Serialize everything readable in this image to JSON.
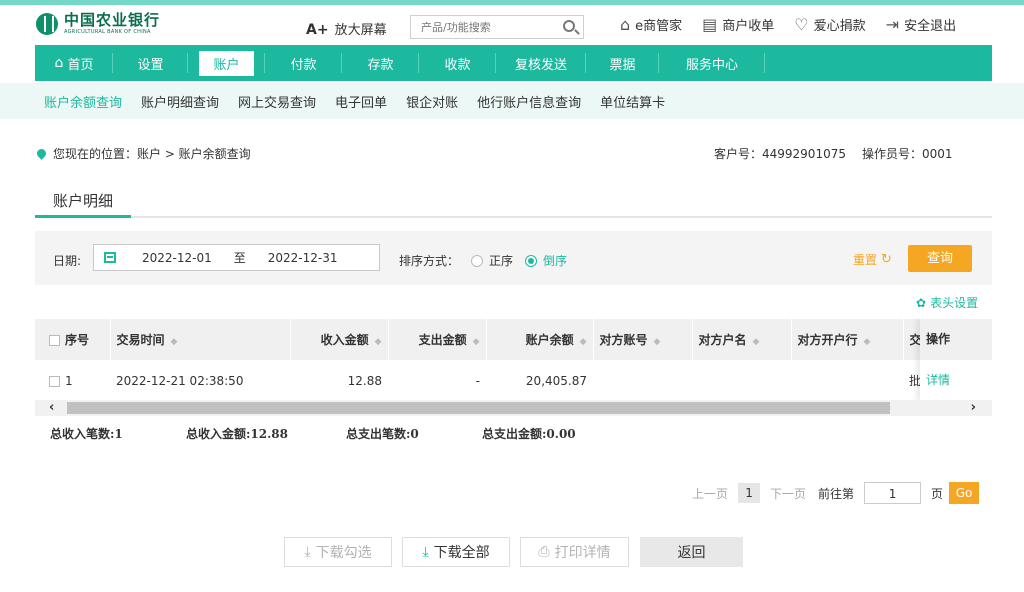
{
  "brand": {
    "name_cn": "中国农业银行",
    "name_en": "AGRICULTURAL BANK OF CHINA"
  },
  "header": {
    "zoom_symbol": "A+",
    "zoom_label": "放大屏幕",
    "search_placeholder": "产品/功能搜索",
    "links": [
      "e商管家",
      "商户收单",
      "爱心捐款",
      "安全退出"
    ]
  },
  "nav": {
    "items": [
      "首页",
      "设置",
      "账户",
      "付款",
      "存款",
      "收款",
      "复核发送",
      "票据",
      "服务中心"
    ],
    "active": "账户"
  },
  "subnav": {
    "items": [
      "账户余额查询",
      "账户明细查询",
      "网上交易查询",
      "电子回单",
      "银企对账",
      "他行账户信息查询",
      "单位结算卡"
    ],
    "active": "账户余额查询"
  },
  "breadcrumb": {
    "text": "您现在的位置：账户 > 账户余额查询"
  },
  "customer": {
    "label": "客户号：44992901075",
    "operator": "操作员号：0001"
  },
  "section": {
    "tab": "账户明细"
  },
  "filter": {
    "date_label": "日期:",
    "start_date": "2022-12-01",
    "to": "至",
    "end_date": "2022-12-31",
    "sort_label": "排序方式：",
    "sort_asc": "正序",
    "sort_desc": "倒序",
    "sort_selected": "倒序",
    "reset": "重置",
    "query": "查询"
  },
  "column_settings": "表头设置",
  "table": {
    "headers": [
      "序号",
      "交易时间",
      "收入金额",
      "支出金额",
      "账户余额",
      "对方账号",
      "对方户名",
      "对方开户行",
      "交易"
    ],
    "rows": [
      {
        "index": "1",
        "time": "2022-12-21 02:38:50",
        "income": "12.88",
        "expense": "-",
        "balance": "20,405.87",
        "acct": "",
        "name": "",
        "bank": "",
        "trade": "批"
      }
    ],
    "op_header": "操作",
    "op_action": "详情"
  },
  "totals": {
    "income_count": "总收入笔数:1",
    "income_amount": "总收入金额:12.88",
    "expense_count": "总支出笔数:0",
    "expense_amount": "总支出金额:0.00"
  },
  "pager": {
    "prev": "上一页",
    "current": "1",
    "next": "下一页",
    "goto": "前往第",
    "input": "1",
    "unit": "页",
    "go": "Go"
  },
  "actions": {
    "download_selected": "下载勾选",
    "download_all": "下载全部",
    "print": "打印详情",
    "back": "返回"
  },
  "colors": {
    "accent": "#1cb99f",
    "orange": "#f5a623"
  }
}
